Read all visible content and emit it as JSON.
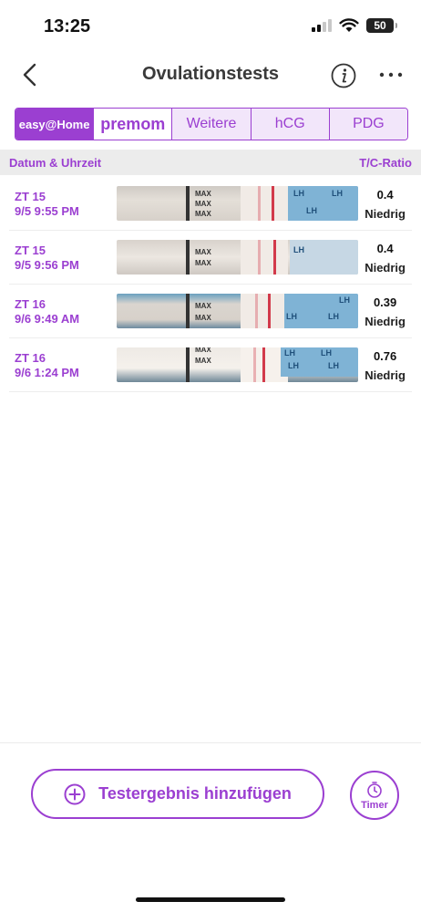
{
  "status_bar": {
    "time": "13:25",
    "battery": "50"
  },
  "nav": {
    "title": "Ovulationstests"
  },
  "brand_tabs": [
    {
      "label": "easy@Home",
      "active": true
    },
    {
      "label": "premom",
      "active": false
    },
    {
      "label": "Weitere",
      "active": false
    },
    {
      "label": "hCG",
      "active": false
    },
    {
      "label": "PDG",
      "active": false
    }
  ],
  "table": {
    "col_left": "Datum & Uhrzeit",
    "col_right": "T/C-Ratio",
    "rows": [
      {
        "cycle_day": "ZT 15",
        "datetime": "9/5 9:55 PM",
        "ratio": "0.4",
        "level": "Niedrig"
      },
      {
        "cycle_day": "ZT 15",
        "datetime": "9/5 9:56 PM",
        "ratio": "0.4",
        "level": "Niedrig"
      },
      {
        "cycle_day": "ZT 16",
        "datetime": "9/6 9:49 AM",
        "ratio": "0.39",
        "level": "Niedrig"
      },
      {
        "cycle_day": "ZT 16",
        "datetime": "9/6 1:24 PM",
        "ratio": "0.76",
        "level": "Niedrig"
      }
    ],
    "strip_text": {
      "max": "MAX",
      "lh": "LH"
    }
  },
  "actions": {
    "add_label": "Testergebnis hinzufügen",
    "timer_label": "Timer"
  },
  "colors": {
    "accent": "#9b3fd1",
    "test_line": "#d23a4b",
    "strip_blue": "#7fb3d5"
  },
  "icons": [
    "back-chevron-icon",
    "info-icon",
    "more-icon",
    "plus-circle-icon",
    "timer-icon"
  ]
}
